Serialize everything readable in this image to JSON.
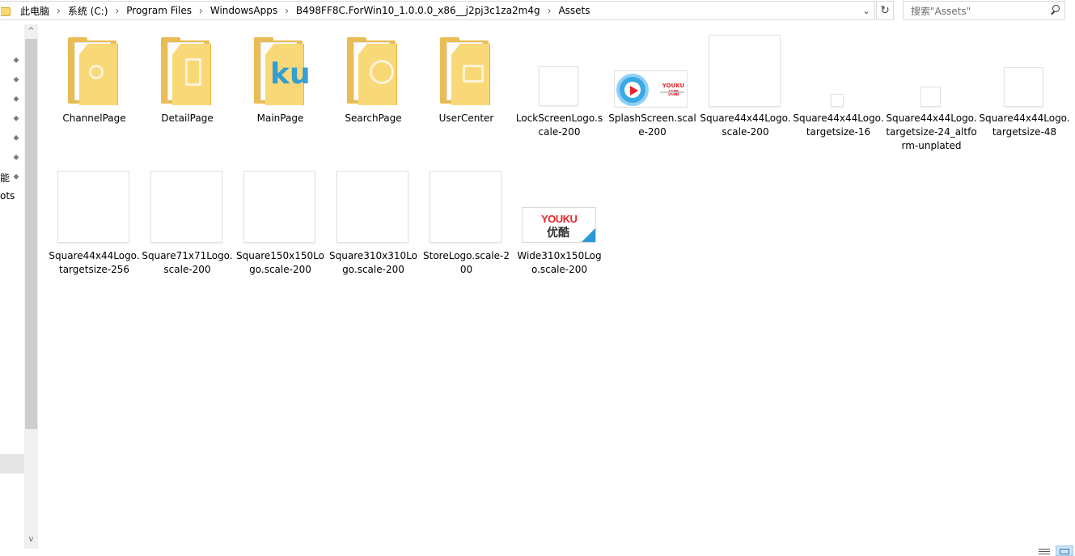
{
  "address": {
    "crumbs": [
      "此电脑",
      "系统 (C:)",
      "Program Files",
      "WindowsApps",
      "B498FF8C.ForWin10_1.0.0.0_x86__j2pj3c1za2m4g",
      "Assets"
    ],
    "separator": "›",
    "dropdown_glyph": "⌄",
    "refresh_glyph": "↻"
  },
  "search": {
    "placeholder": "搜索\"Assets\""
  },
  "nav": {
    "fragment_1": "能",
    "fragment_2": "ots",
    "pin_glyph": "📌"
  },
  "scroll": {
    "up_glyph": "^",
    "down_glyph": "v"
  },
  "items": [
    {
      "name": "ChannelPage",
      "kind": "folder"
    },
    {
      "name": "DetailPage",
      "kind": "folder"
    },
    {
      "name": "MainPage",
      "kind": "folder"
    },
    {
      "name": "SearchPage",
      "kind": "folder"
    },
    {
      "name": "UserCenter",
      "kind": "folder"
    },
    {
      "name": "LockScreenLogo.scale-200",
      "kind": "image"
    },
    {
      "name": "SplashScreen.scale-200",
      "kind": "image"
    },
    {
      "name": "Square44x44Logo.scale-200",
      "kind": "image"
    },
    {
      "name": "Square44x44Logo.targetsize-16",
      "kind": "image"
    },
    {
      "name": "Square44x44Logo.targetsize-24_altform-unplated",
      "kind": "image"
    },
    {
      "name": "Square44x44Logo.targetsize-48",
      "kind": "image"
    },
    {
      "name": "Square44x44Logo.targetsize-256",
      "kind": "image"
    },
    {
      "name": "Square71x71Logo.scale-200",
      "kind": "image"
    },
    {
      "name": "Square150x150Logo.scale-200",
      "kind": "image"
    },
    {
      "name": "Square310x310Logo.scale-200",
      "kind": "image"
    },
    {
      "name": "StoreLogo.scale-200",
      "kind": "image"
    },
    {
      "name": "Wide310x150Logo.scale-200",
      "kind": "image"
    }
  ],
  "thumb_text": {
    "mainpage_glyph": "ku",
    "splash_brand": "YOUKU优酷",
    "wide_brand_latin": "YOUKU",
    "wide_brand_cn": "优酷"
  },
  "colors": {
    "folder": "#f9d878",
    "youku_red": "#e8232a",
    "youku_blue": "#2a9ad6"
  }
}
